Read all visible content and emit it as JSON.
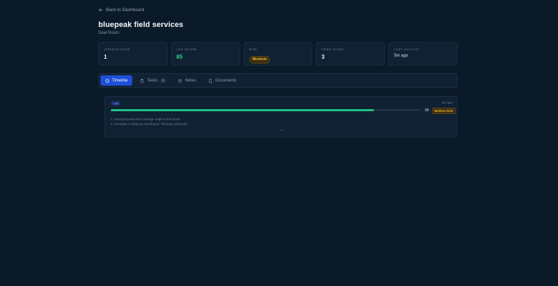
{
  "nav": {
    "back_label": "Back to Dashboard"
  },
  "header": {
    "title": "bluepeak field services",
    "subtitle": "Deal Room"
  },
  "stats": [
    {
      "label": "INTERACTIONS",
      "value": "1"
    },
    {
      "label": "AVG SCORE",
      "value": "85"
    },
    {
      "label": "RISK",
      "value": "Medium"
    },
    {
      "label": "OPEN TASKS",
      "value": "3"
    },
    {
      "label": "LAST ACTIVITY",
      "value": "5m ago"
    }
  ],
  "tabs": [
    {
      "label": "Timeline",
      "icon": "clock-icon",
      "active": true
    },
    {
      "label": "Tasks",
      "icon": "clipboard-icon",
      "count": "3"
    },
    {
      "label": "Notes",
      "icon": "edit-icon"
    },
    {
      "label": "Documents",
      "icon": "document-icon"
    }
  ],
  "timeline": {
    "items": [
      {
        "type": "Call",
        "time": "5m ago",
        "score": "85",
        "score_fraction": 0.85,
        "risk": "Medium Risk",
        "steps": [
          "1. Send proposal and coverage maps to the buyer.",
          "2. Schedule a follow-up meeting for Thursday afternoon."
        ]
      }
    ]
  },
  "colors": {
    "background": "#0b1a29",
    "accent": "#1e4fd6",
    "score_green": "#22c58b",
    "risk_amber": "#f0b429"
  }
}
